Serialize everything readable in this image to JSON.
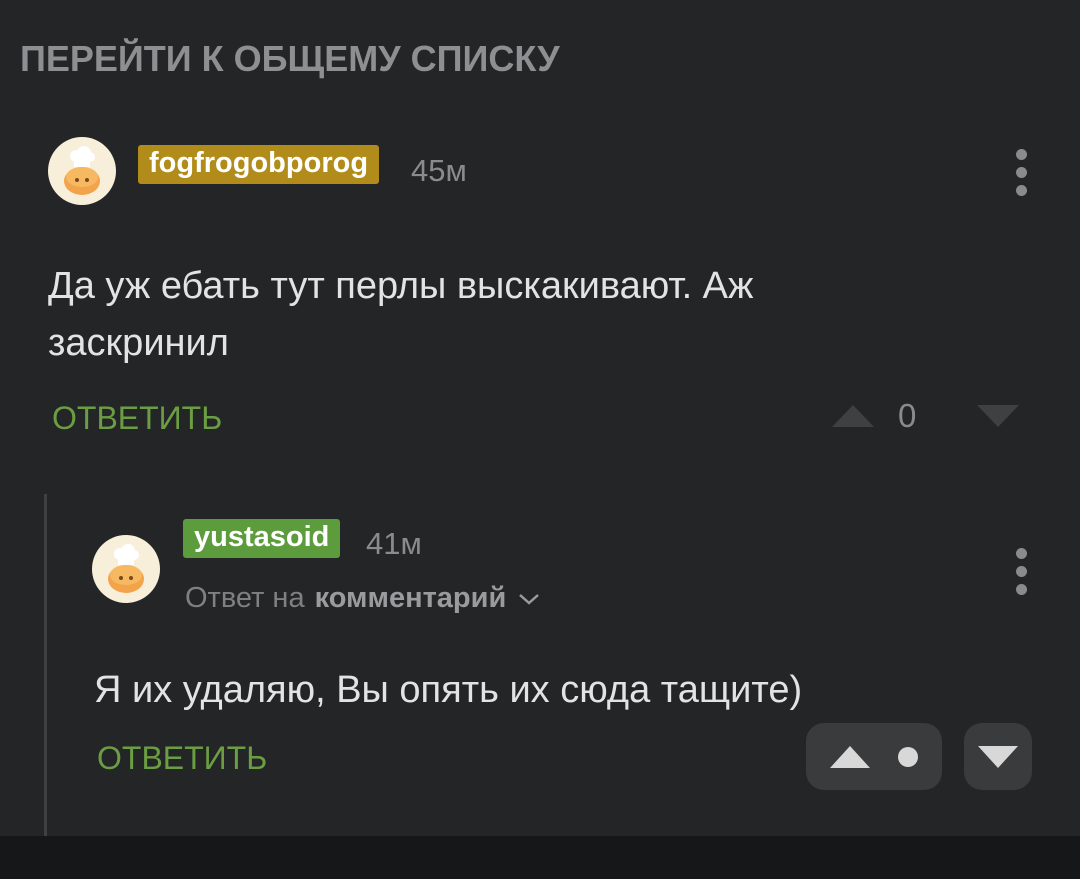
{
  "nav": {
    "back_to_list": "ПЕРЕЙТИ К ОБЩЕМУ СПИСКУ"
  },
  "comments": [
    {
      "author": "fogfrogobporog",
      "author_badge_color": "#b28c1a",
      "time": "45м",
      "text_line1": "Да уж ебать тут перлы выскакивают. Аж",
      "text_line2": "заскринил",
      "reply_label": "ОТВЕТИТЬ",
      "score": "0",
      "avatar_icon": "chef-cookie-avatar-icon"
    },
    {
      "author": "yustasoid",
      "author_badge_color": "#5d9c3c",
      "time": "41м",
      "reply_to_prefix": "Ответ на",
      "reply_to_target": "комментарий",
      "text": "Я их удаляю, Вы опять их сюда тащите)",
      "reply_label": "ОТВЕТИТЬ",
      "avatar_icon": "chef-cookie-avatar-icon"
    }
  ],
  "colors": {
    "background": "#232527",
    "accent_green": "#6b9e42"
  }
}
